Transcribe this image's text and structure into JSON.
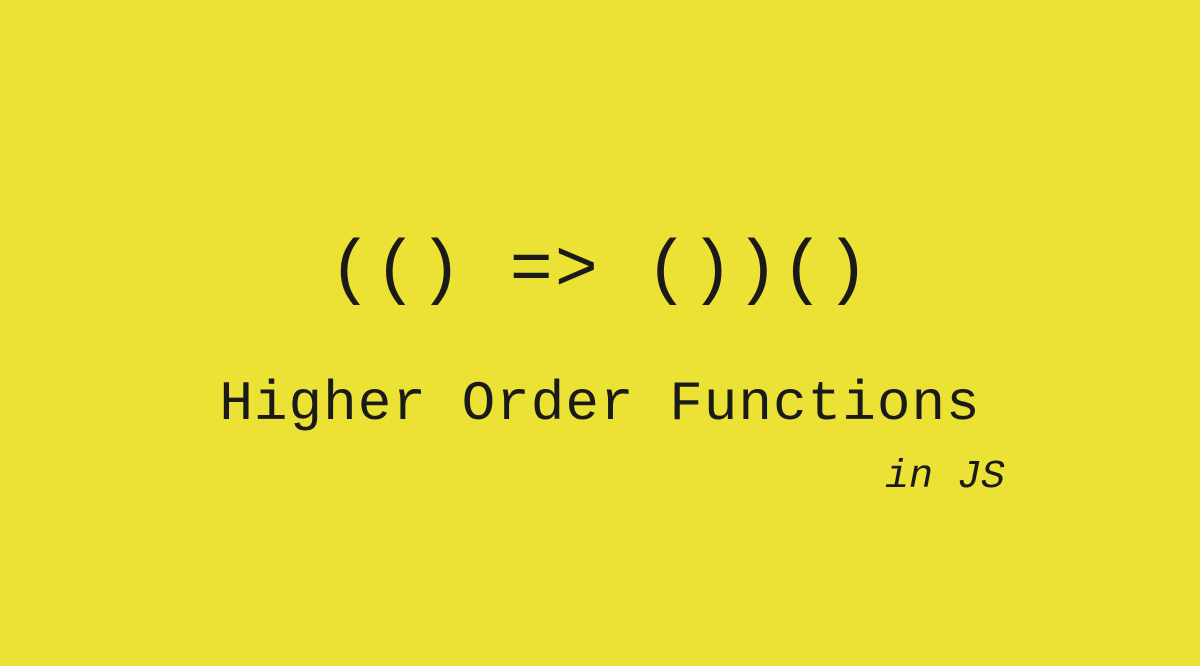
{
  "slide": {
    "code_snippet": "(() => ())()",
    "title": "Higher Order Functions",
    "subtitle": "in JS"
  },
  "colors": {
    "background": "#ece135",
    "text": "#1a1a1a"
  }
}
